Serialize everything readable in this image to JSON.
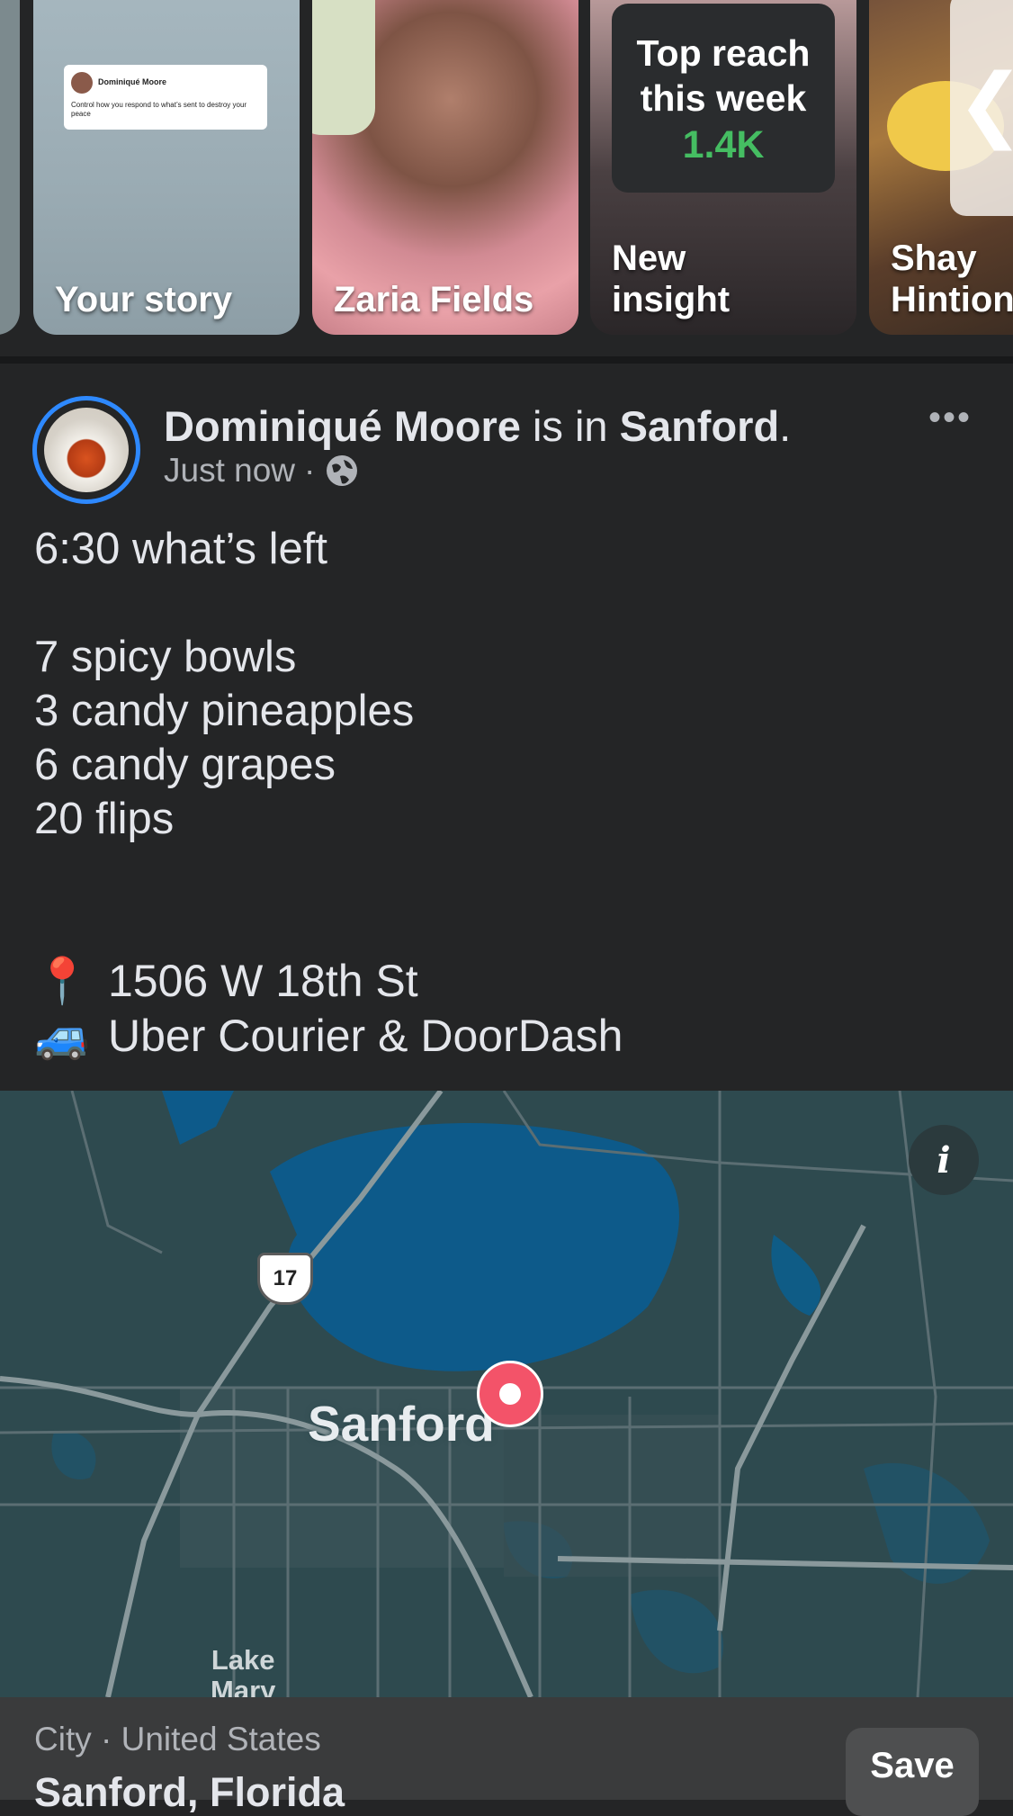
{
  "stories": {
    "items": [
      {
        "label": "Your story",
        "preview_name": "Dominiqué Moore",
        "preview_text": "Control how you respond to what’s sent to destroy your peace"
      },
      {
        "label": "Zaria Fields"
      },
      {
        "label": "New\ninsight",
        "card_title": "Top reach\nthis week",
        "card_value": "1.4K"
      },
      {
        "label": "Shay\nHintion"
      }
    ],
    "nav_arrow": "❮"
  },
  "post": {
    "author": "Dominiqué Moore",
    "connector": "is in",
    "place": "Sanford",
    "period": ".",
    "timestamp": "Just now",
    "separator": "·",
    "audience_icon": "globe-icon",
    "more_icon": "•••",
    "text_lines": [
      "6:30 what’s left",
      "",
      "7 spicy bowls",
      "3 candy pineapples",
      "6 candy grapes",
      "20 flips"
    ],
    "address_emoji": "📍",
    "address": "1506 W 18th St",
    "delivery_emoji": "🚙",
    "delivery": "Uber Courier & DoorDash"
  },
  "map": {
    "city_label": "Sanford",
    "nearby_label": "Lake\nMary",
    "route_shield": "17",
    "info_icon": "i"
  },
  "place_card": {
    "subtitle": "City · United States",
    "name": "Sanford, Florida",
    "save_label": "Save"
  },
  "colors": {
    "background": "#242526",
    "avatar_ring": "#2e89ff",
    "insight_value": "#45bd62",
    "map_water": "#0d5a8a",
    "map_pin": "#f35369"
  }
}
